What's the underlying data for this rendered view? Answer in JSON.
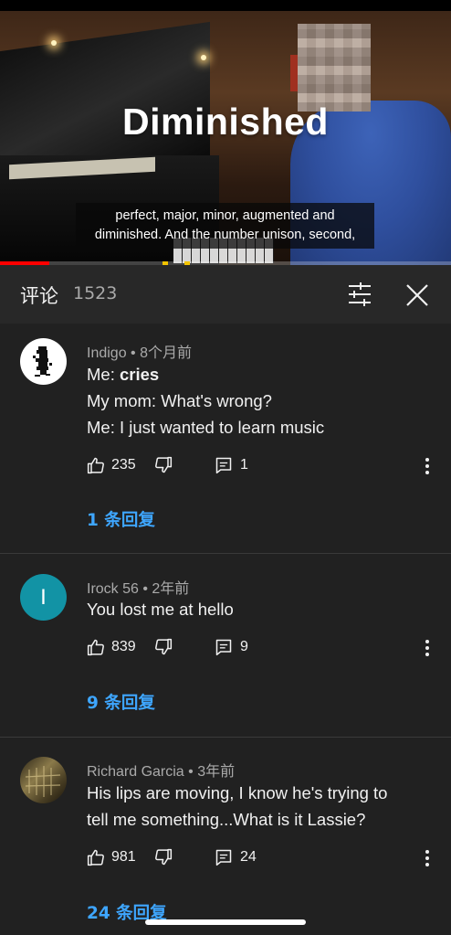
{
  "video": {
    "overlay_title": "Diminished",
    "subtitle_line1": "perfect, major, minor, augmented and",
    "subtitle_line2": "diminished. And the number unison, second,",
    "progress_fraction": 0.11
  },
  "header": {
    "title": "评论",
    "count": "1523"
  },
  "icons": {
    "filter": "tune-sliders-icon",
    "close": "close-icon",
    "like": "thumbs-up-icon",
    "dislike": "thumbs-down-icon",
    "reply": "comment-icon",
    "more": "more-vert-icon"
  },
  "colors": {
    "background": "#212121",
    "header": "#282828",
    "link": "#3ea6ff",
    "avatar_irock": "#1293a5"
  },
  "comments": [
    {
      "author": "Indigo",
      "time": "8个月前",
      "meta": "Indigo • 8个月前",
      "lines": [
        "Me: ",
        "cries",
        "My mom: What's wrong?",
        "Me: I just wanted to learn music"
      ],
      "likes": "235",
      "reply_count": "1",
      "replies_label": "1 条回复"
    },
    {
      "author": "Irock 56",
      "time": "2年前",
      "meta": "Irock 56 • 2年前",
      "avatar_letter": "I",
      "lines": [
        "You lost me at hello"
      ],
      "likes": "839",
      "reply_count": "9",
      "replies_label": "9 条回复"
    },
    {
      "author": "Richard Garcia",
      "time": "3年前",
      "meta": "Richard Garcia • 3年前",
      "lines": [
        "His lips are moving, I know he's trying to",
        "tell me something...What is it Lassie?"
      ],
      "likes": "981",
      "reply_count": "24",
      "replies_label": "24 条回复"
    }
  ]
}
